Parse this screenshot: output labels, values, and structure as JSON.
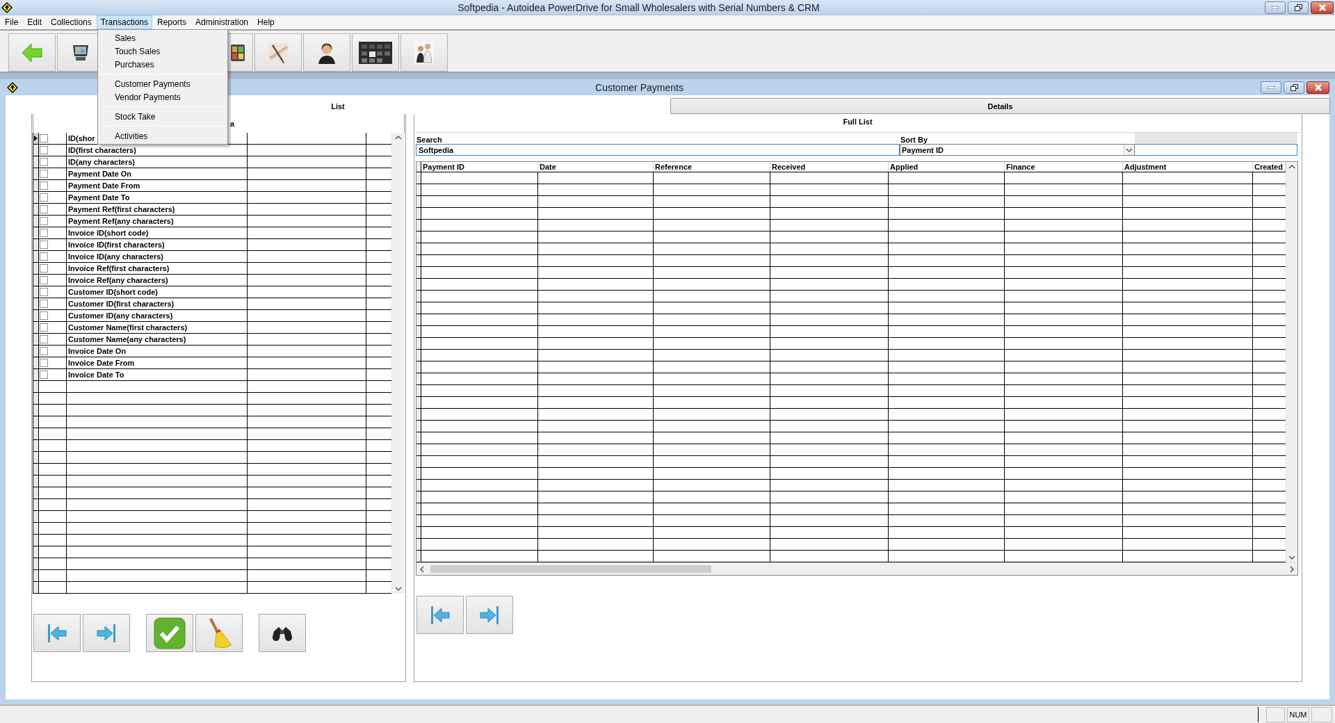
{
  "window": {
    "title": "Softpedia - Autoidea PowerDrive for Small Wholesalers with Serial Numbers & CRM"
  },
  "menu_bar": [
    {
      "label": "File",
      "selected": false
    },
    {
      "label": "Edit",
      "selected": false
    },
    {
      "label": "Collections",
      "selected": false
    },
    {
      "label": "Transactions",
      "selected": true
    },
    {
      "label": "Reports",
      "selected": false
    },
    {
      "label": "Administration",
      "selected": false
    },
    {
      "label": "Help",
      "selected": false
    }
  ],
  "open_menu": {
    "groups": [
      {
        "items": [
          "Sales",
          "Touch Sales",
          "Purchases"
        ]
      },
      {
        "items": [
          "Customer Payments",
          "Vendor Payments"
        ]
      },
      {
        "items": [
          "Stock Take"
        ]
      },
      {
        "items": [
          "Activities"
        ]
      }
    ]
  },
  "toolbar": [
    {
      "kind": "back"
    },
    {
      "kind": "terminal"
    },
    {
      "kind": "tablet"
    },
    {
      "kind": "pen"
    },
    {
      "kind": "support"
    },
    {
      "kind": "cubes"
    },
    {
      "kind": "meeting"
    }
  ],
  "child_window": {
    "title": "Customer Payments"
  },
  "tabs": [
    {
      "label": "List",
      "selected": true
    },
    {
      "label": "Details",
      "selected": false
    }
  ],
  "criteria_panel": {
    "header": "a",
    "rows": [
      {
        "label": "ID(shor",
        "checked": false,
        "current": true
      },
      {
        "label": "ID(first characters)",
        "checked": false,
        "current": false
      },
      {
        "label": "ID(any characters)",
        "checked": false,
        "current": false
      },
      {
        "label": "Payment Date On",
        "checked": false,
        "current": false
      },
      {
        "label": "Payment Date From",
        "checked": false,
        "current": false
      },
      {
        "label": "Payment Date To",
        "checked": false,
        "current": false
      },
      {
        "label": "Payment Ref(first characters)",
        "checked": false,
        "current": false
      },
      {
        "label": "Payment Ref(any characters)",
        "checked": false,
        "current": false
      },
      {
        "label": "Invoice ID(short code)",
        "checked": false,
        "current": false
      },
      {
        "label": "Invoice ID(first characters)",
        "checked": false,
        "current": false
      },
      {
        "label": "Invoice ID(any characters)",
        "checked": false,
        "current": false
      },
      {
        "label": "Invoice Ref(first characters)",
        "checked": false,
        "current": false
      },
      {
        "label": "Invoice Ref(any characters)",
        "checked": false,
        "current": false
      },
      {
        "label": "Customer ID(short code)",
        "checked": false,
        "current": false
      },
      {
        "label": "Customer ID(first characters)",
        "checked": false,
        "current": false
      },
      {
        "label": "Customer ID(any characters)",
        "checked": false,
        "current": false
      },
      {
        "label": "Customer Name(first characters)",
        "checked": false,
        "current": false
      },
      {
        "label": "Customer Name(any characters)",
        "checked": false,
        "current": false
      },
      {
        "label": "Invoice Date On",
        "checked": false,
        "current": false
      },
      {
        "label": "Invoice Date From",
        "checked": false,
        "current": false
      },
      {
        "label": "Invoice Date To",
        "checked": false,
        "current": false
      }
    ],
    "button_groups": [
      [
        {
          "kind": "first"
        },
        {
          "kind": "last"
        }
      ],
      [
        {
          "kind": "apply"
        },
        {
          "kind": "clear"
        }
      ],
      [
        {
          "kind": "find"
        }
      ]
    ]
  },
  "list_panel": {
    "caption": "Full List",
    "search": {
      "label": "Search",
      "value": "Softpedia",
      "focused": true
    },
    "sort_by": {
      "label": "Sort By",
      "value": "Payment ID"
    },
    "columns": [
      "Payment ID",
      "Date",
      "Reference",
      "Received",
      "Applied",
      "Finance",
      "Adjustment",
      "Created"
    ],
    "button_groups": [
      [
        {
          "kind": "first"
        },
        {
          "kind": "last"
        }
      ]
    ]
  },
  "status_bar": {
    "num_lock": "NUM"
  }
}
